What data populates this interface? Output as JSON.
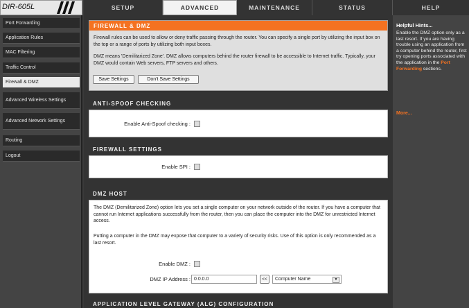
{
  "brand": {
    "model": "DIR-605L"
  },
  "tabs": [
    {
      "label": "SETUP"
    },
    {
      "label": "ADVANCED"
    },
    {
      "label": "MAINTENANCE"
    },
    {
      "label": "STATUS"
    },
    {
      "label": "HELP"
    }
  ],
  "sidebar": {
    "items": [
      {
        "label": "Port Forwarding"
      },
      {
        "label": "Application Rules"
      },
      {
        "label": "MAC Filtering"
      },
      {
        "label": "Traffic Control"
      },
      {
        "label": "Firewall & DMZ"
      },
      {
        "label": "Advanced Wireless Settings"
      },
      {
        "label": "Advanced Network Settings"
      },
      {
        "label": "Routing"
      },
      {
        "label": "Logout"
      }
    ]
  },
  "firewall_dmz": {
    "title": "FIREWALL & DMZ",
    "p1": "Firewall rules can be used to allow or deny traffic passing through the router. You can specify a single port by utilizing the input box on the top or a range of ports by utilizing both input boxes.",
    "p2": "DMZ means 'Demilitarized Zone'. DMZ allows computers behind the router firewall to be accessible to Internet traffic. Typically, your DMZ would contain Web servers, FTP servers and others.",
    "save_label": "Save Settings",
    "dont_save_label": "Don't Save Settings"
  },
  "anti_spoof": {
    "title": "ANTI-SPOOF CHECKING",
    "label": "Enable Anti-Spoof checking :"
  },
  "firewall_settings": {
    "title": "FIREWALL SETTINGS",
    "spi_label": "Enable SPI :"
  },
  "dmz_host": {
    "title": "DMZ HOST",
    "p1": "The DMZ (Demilitarized Zone) option lets you set a single computer on your network outside of the router. If you have a computer that cannot run Internet applications successfully from the router, then you can place the computer into the DMZ for unrestricted Internet access.",
    "p2": "Putting a computer in the DMZ may expose that computer to a variety of security risks. Use of this option is only recommended as a last resort.",
    "enable_label": "Enable DMZ :",
    "ip_label": "DMZ IP Address :",
    "ip_value": "0.0.0.0",
    "copy_button": "<<",
    "computer_select": "Computer Name"
  },
  "alg": {
    "title": "APPLICATION LEVEL GATEWAY (ALG) CONFIGURATION"
  },
  "help": {
    "title": "Helpful Hints...",
    "text_pre": "Enable the DMZ option only as a last resort. If you are having trouble using an application from a computer behind the router, first try opening ports associated with the application in the ",
    "link": "Port Forwarding",
    "text_post": " sections.",
    "more": "More..."
  }
}
